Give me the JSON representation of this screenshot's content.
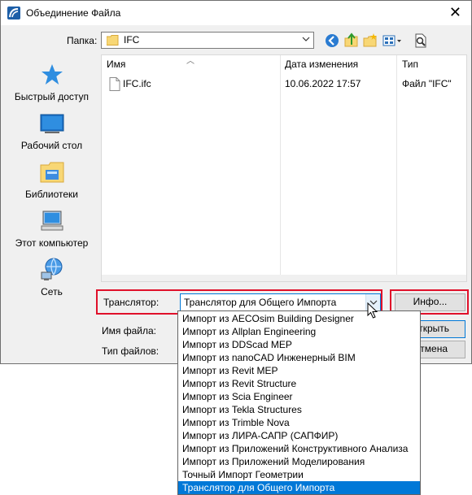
{
  "window": {
    "title": "Объединение Файла",
    "close_glyph": "✕"
  },
  "toolbar": {
    "folder_label": "Папка:",
    "folder_value": "IFC",
    "icons": [
      "back-icon",
      "up-folder-icon",
      "new-folder-icon",
      "view-menu-icon",
      "preview-icon"
    ]
  },
  "places": [
    {
      "label": "Быстрый доступ",
      "icon": "star-icon"
    },
    {
      "label": "Рабочий стол",
      "icon": "desktop-icon"
    },
    {
      "label": "Библиотеки",
      "icon": "libraries-icon"
    },
    {
      "label": "Этот компьютер",
      "icon": "computer-icon"
    },
    {
      "label": "Сеть",
      "icon": "network-icon"
    }
  ],
  "filelist": {
    "columns": [
      "Имя",
      "Дата изменения",
      "Тип"
    ],
    "rows": [
      {
        "name": "IFC.ifc",
        "date": "10.06.2022 17:57",
        "type": "Файл \"IFC\""
      }
    ]
  },
  "translator": {
    "label": "Транслятор:",
    "value": "Транслятор для Общего Импорта",
    "info_button": "Инфо..."
  },
  "filename_label": "Имя файла:",
  "filetype_label": "Тип файлов:",
  "open_button": "Открыть",
  "cancel_button": "Отмена",
  "dropdown": {
    "items": [
      "Импорт из AECOsim Building Designer",
      "Импорт из Allplan Engineering",
      "Импорт из DDScad MEP",
      "Импорт из nanoCAD Инженерный BIM",
      "Импорт из Revit MEP",
      "Импорт из Revit Structure",
      "Импорт из Scia Engineer",
      "Импорт из Tekla Structures",
      "Импорт из Trimble Nova",
      "Импорт из ЛИРА-САПР (САПФИР)",
      "Импорт из Приложений Конструктивного Анализа",
      "Импорт из Приложений Моделирования",
      "Точный Импорт Геометрии",
      "Транслятор для Общего Импорта"
    ],
    "selected_index": 13
  },
  "colors": {
    "accent": "#0078d7",
    "highlight": "#e0102a",
    "folder": "#f8d775"
  }
}
